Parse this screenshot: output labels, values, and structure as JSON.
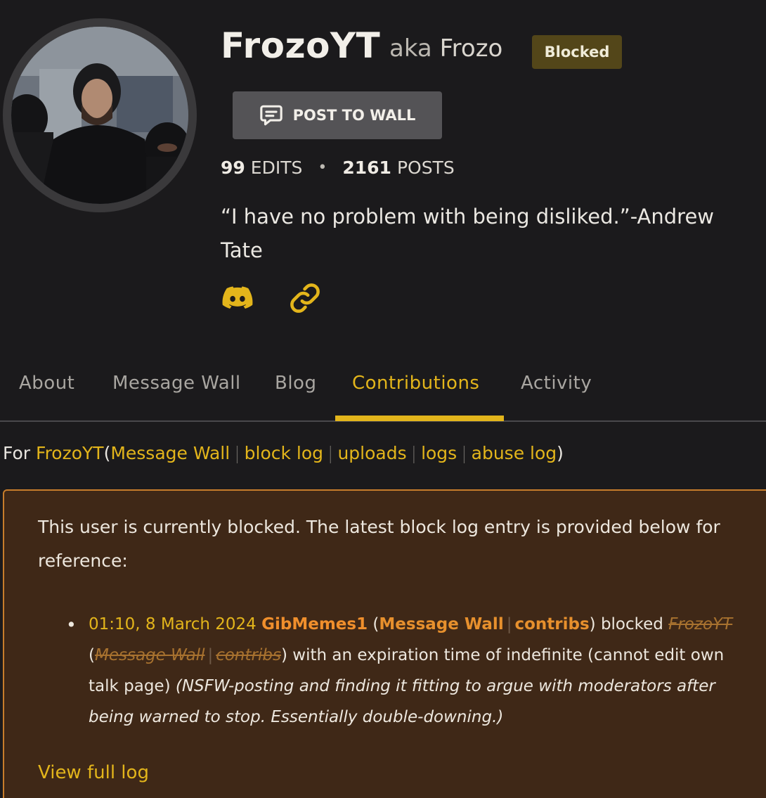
{
  "profile": {
    "username": "FrozoYT",
    "aka_label": "aka",
    "aka_name": "Frozo",
    "badge": "Blocked",
    "post_button": "POST TO WALL",
    "edits_count": "99",
    "edits_label": "EDITS",
    "posts_count": "2161",
    "posts_label": "POSTS",
    "stats_separator": "•",
    "bio": "“I have no problem with being disliked.”-Andrew Tate",
    "social": [
      "discord-icon",
      "link-icon"
    ],
    "accent_color": "#e3b51b"
  },
  "tabs": [
    {
      "label": "About"
    },
    {
      "label": "Message Wall"
    },
    {
      "label": "Blog"
    },
    {
      "label": "Contributions",
      "active": true
    },
    {
      "label": "Activity"
    }
  ],
  "subnav": {
    "prefix": "For",
    "user": "FrozoYT",
    "open_paren": "(",
    "links": [
      "Message Wall",
      "block log",
      "uploads",
      "logs",
      "abuse log"
    ],
    "close_paren": ")"
  },
  "block_notice": {
    "intro": "This user is currently blocked. The latest block log entry is provided below for reference:",
    "entry": {
      "timestamp": "01:10, 8 March 2024",
      "actor": "GibMemes1",
      "actor_links": [
        "Message Wall",
        "contribs"
      ],
      "action": "blocked",
      "target": "FrozoYT",
      "target_links": [
        "Message Wall",
        "contribs"
      ],
      "details": "with an expiration time of indefinite (cannot edit own talk page)",
      "reason": "(NSFW-posting and finding it fitting to argue with moderators after being warned to stop. Essentially double-downing.)"
    },
    "view_full_log": "View full log",
    "border_color": "#c77d2b",
    "background_color": "#3f2817"
  }
}
